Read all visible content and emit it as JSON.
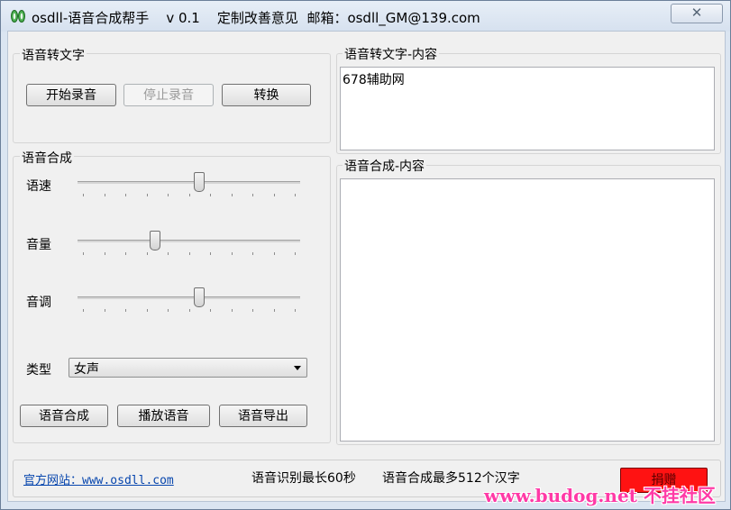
{
  "window": {
    "title": "osdll-语音合成帮手    v 0.1    定制改善意见  邮箱：osdll_GM@139.com",
    "close_icon": "✕"
  },
  "stt": {
    "group_label": "语音转文字",
    "start_btn": "开始录音",
    "stop_btn": "停止录音",
    "convert_btn": "转换"
  },
  "tts": {
    "group_label": "语音合成",
    "speed_label": "语速",
    "speed_value": 0.55,
    "volume_label": "音量",
    "volume_value": 0.34,
    "pitch_label": "音调",
    "pitch_value": 0.55,
    "type_label": "类型",
    "type_value": "女声",
    "synth_btn": "语音合成",
    "play_btn": "播放语音",
    "export_btn": "语音导出"
  },
  "stt_content": {
    "label": "语音转文字-内容",
    "text": "678辅助网"
  },
  "tts_content": {
    "label": "语音合成-内容",
    "text": ""
  },
  "footer": {
    "site_link": "官方网站：www.osdll.com",
    "stt_limit": "语音识别最长60秒",
    "tts_limit": "语音合成最多512个汉字",
    "donate_btn": "捐赠",
    "watermark": "www.budog.net 不挂社区"
  },
  "colors": {
    "donate": "#ff1212",
    "link": "#0645ad",
    "watermark": "#ff3aa6"
  }
}
